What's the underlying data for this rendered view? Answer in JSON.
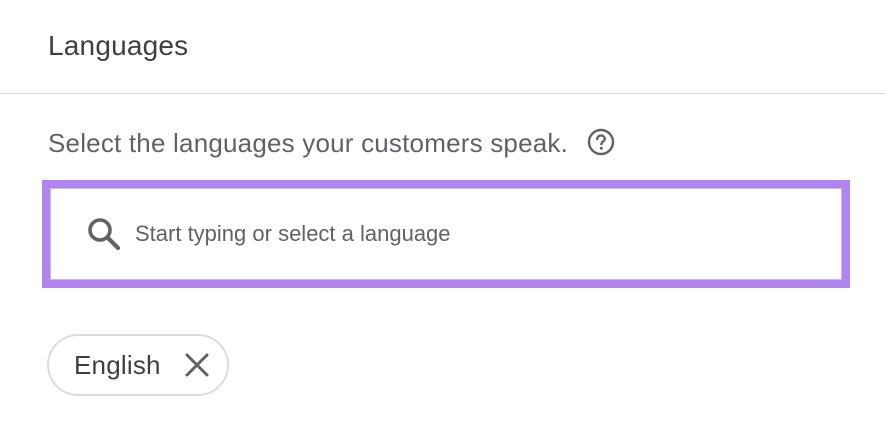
{
  "header": {
    "title": "Languages"
  },
  "instruction": {
    "text": "Select the languages your customers speak.",
    "help_icon": "help-circle-icon"
  },
  "search": {
    "placeholder": "Start typing or select a language",
    "value": "",
    "icon": "search-icon",
    "highlight_color": "#b184f0"
  },
  "selected_languages": [
    {
      "label": "English",
      "remove_icon": "close-icon"
    }
  ],
  "colors": {
    "text_primary": "#3c4043",
    "text_secondary": "#5f6368",
    "divider": "#dadce0",
    "highlight": "#b184f0"
  }
}
